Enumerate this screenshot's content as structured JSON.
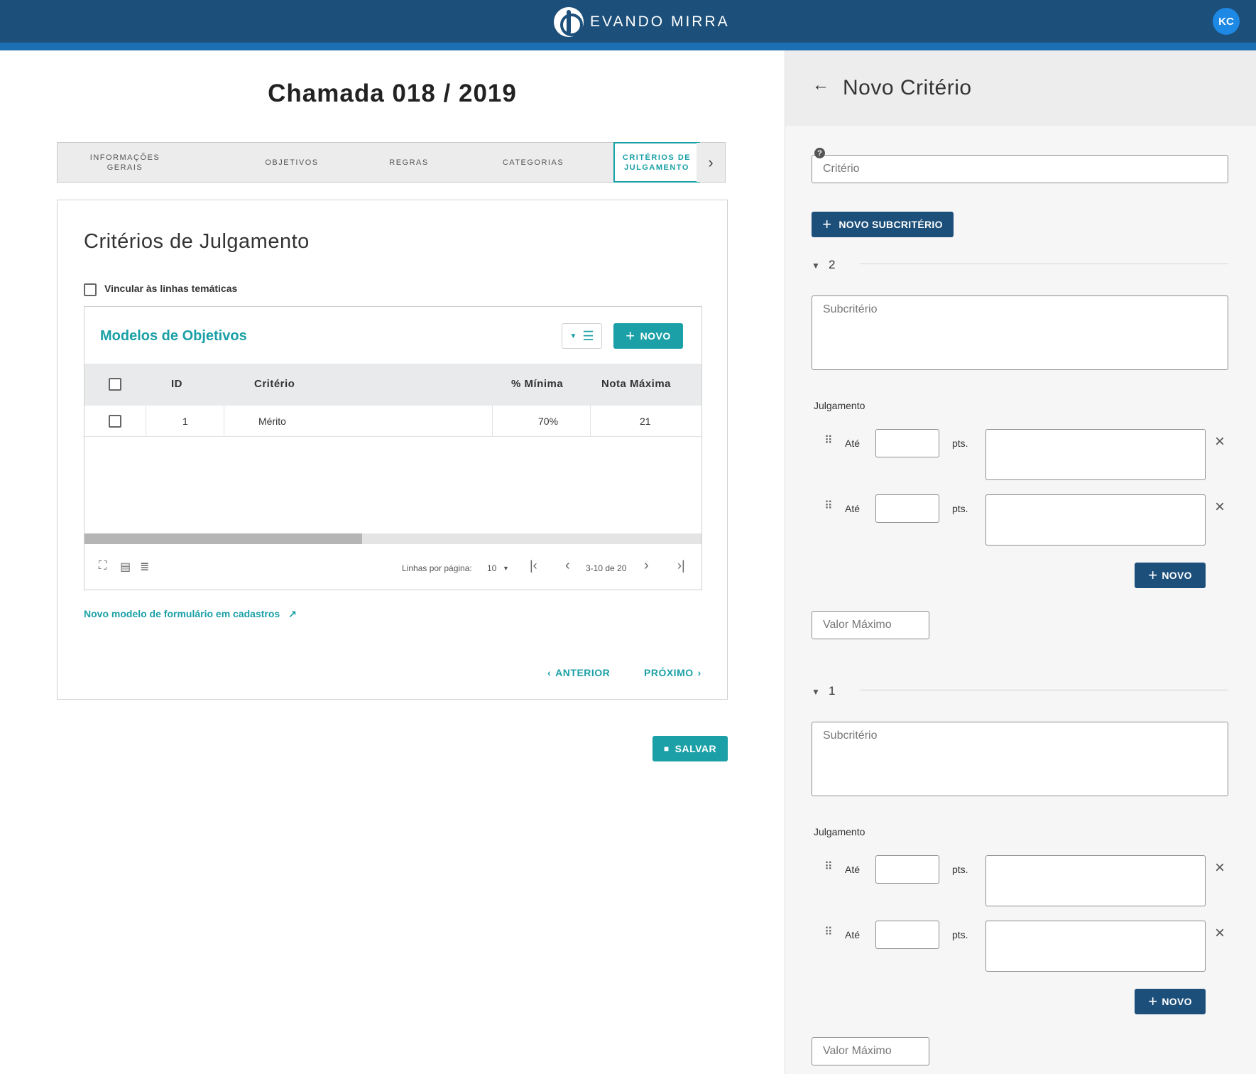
{
  "header": {
    "brand": "EVANDO MIRRA",
    "avatar_initials": "KC"
  },
  "page": {
    "title": "Chamada 018 / 2019"
  },
  "tabs": [
    {
      "line1": "INFORMAÇÕES",
      "line2": "GERAIS"
    },
    {
      "line1": "OBJETIVOS",
      "line2": ""
    },
    {
      "line1": "REGRAS",
      "line2": ""
    },
    {
      "line1": "CATEGORIAS",
      "line2": ""
    },
    {
      "line1": "CRITÉRIOS DE",
      "line2": "JULGAMENTO"
    }
  ],
  "card": {
    "title": "Critérios de Julgamento",
    "vincular_label": "Vincular às linhas temáticas",
    "grid": {
      "title": "Modelos de Objetivos",
      "new_label": "NOVO",
      "columns": [
        "ID",
        "Critério",
        "% Mínima",
        "Nota Máxima"
      ],
      "rows": [
        {
          "id": "1",
          "criterio": "Mérito",
          "minima": "70%",
          "nota": "21"
        }
      ],
      "rows_per_page_label": "Linhas por página:",
      "rows_per_page": "10",
      "range": "3-10 de 20",
      "scroll_fraction": 0.45
    },
    "link_label": "Novo modelo de formulário em cadastros",
    "prev_label": "ANTERIOR",
    "next_label": "PRÓXIMO"
  },
  "save_label": "SALVAR",
  "panel": {
    "title": "Novo Critério",
    "criterio_placeholder": "Critério",
    "new_sub_label": "NOVO SUBCRITÉRIO",
    "sections": [
      {
        "number": "2",
        "sub_placeholder": "Subcritério",
        "julgamento_label": "Julgamento",
        "ate_label": "Até",
        "pts_label": "pts.",
        "new_label": "NOVO",
        "valor_placeholder": "Valor Máximo"
      },
      {
        "number": "1",
        "sub_placeholder": "Subcritério",
        "julgamento_label": "Julgamento",
        "ate_label": "Até",
        "pts_label": "pts.",
        "new_label": "NOVO",
        "valor_placeholder": "Valor Máximo"
      }
    ]
  },
  "colors": {
    "header": "#1c4f7a",
    "accent": "#1aa0a6",
    "navy_button": "#1c4f7a",
    "avatar": "#1e88e5"
  }
}
